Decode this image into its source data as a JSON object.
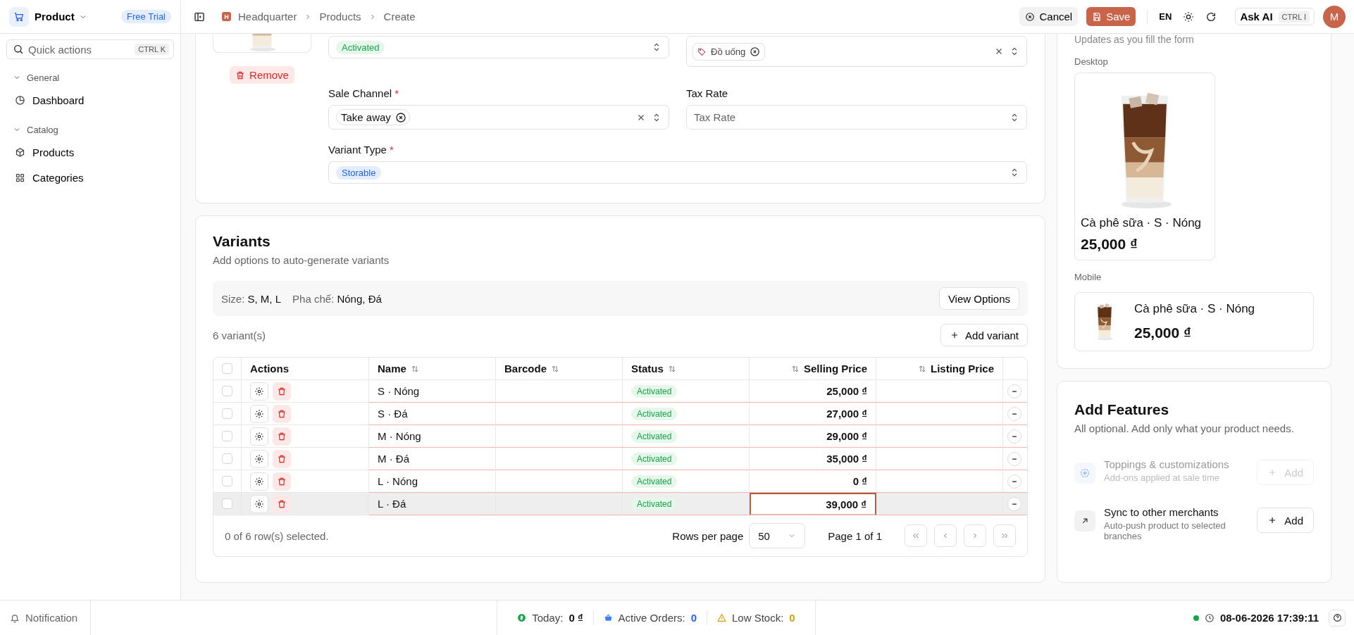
{
  "sidebar": {
    "app_name": "Product",
    "badge": "Free Trial",
    "search": {
      "placeholder": "Quick actions",
      "shortcut": "CTRL K"
    },
    "groups": [
      {
        "label": "General",
        "expanded": true,
        "items": [
          {
            "label": "Dashboard",
            "kind": "dashboard",
            "selected": false
          }
        ]
      },
      {
        "label": "Catalog",
        "expanded": true,
        "items": [
          {
            "label": "Products",
            "kind": "products",
            "selected": false
          },
          {
            "label": "Categories",
            "kind": "categories",
            "selected": false
          }
        ]
      }
    ]
  },
  "breadcrumb": {
    "badge": "H",
    "items": [
      "Headquarter",
      "Products",
      "Create"
    ]
  },
  "toolbar": {
    "cancel": "Cancel",
    "save": "Save",
    "language": "EN",
    "ask_ai": "Ask AI",
    "ask_ai_shortcut": "CTRL I",
    "avatar": "M"
  },
  "product_form": {
    "remove": "Remove",
    "status": {
      "value": "Activated"
    },
    "category": {
      "tag": "Đồ uống"
    },
    "sale_channel": {
      "label": "Sale Channel",
      "required_mark": "*",
      "tag": "Take away"
    },
    "tax_rate": {
      "label": "Tax Rate",
      "placeholder": "Tax Rate"
    },
    "variant_type": {
      "label": "Variant Type",
      "required_mark": "*",
      "value": "Storable"
    }
  },
  "variants": {
    "title": "Variants",
    "subtitle": "Add options to auto-generate variants",
    "options": [
      {
        "name": "Size:",
        "values": "S, M, L"
      },
      {
        "name": "Pha chế:",
        "values": "Nóng, Đá"
      }
    ],
    "view_options": "View Options",
    "count": "6 variant(s)",
    "add_variant": "Add variant",
    "table": {
      "all_selected": false,
      "columns": [
        {
          "label": "Actions",
          "sortable": false,
          "kind": "text"
        },
        {
          "label": "Name",
          "sortable": true,
          "kind": "text"
        },
        {
          "label": "Barcode",
          "sortable": true,
          "kind": "text"
        },
        {
          "label": "Status",
          "sortable": true,
          "kind": "text"
        },
        {
          "label": "Selling Price",
          "sortable": true,
          "kind": "number"
        },
        {
          "label": "Listing Price",
          "sortable": true,
          "kind": "number"
        }
      ],
      "rows": [
        {
          "selected": false,
          "hovered": false,
          "name": "S · Nóng",
          "status": "Activated",
          "selling_price": "25,000 ₫",
          "focused": false
        },
        {
          "selected": false,
          "hovered": false,
          "name": "S · Đá",
          "status": "Activated",
          "selling_price": "27,000 ₫",
          "focused": false
        },
        {
          "selected": false,
          "hovered": false,
          "name": "M · Nóng",
          "status": "Activated",
          "selling_price": "29,000 ₫",
          "focused": false
        },
        {
          "selected": false,
          "hovered": false,
          "name": "M · Đá",
          "status": "Activated",
          "selling_price": "35,000 ₫",
          "focused": false
        },
        {
          "selected": false,
          "hovered": false,
          "name": "L · Nóng",
          "status": "Activated",
          "selling_price": "0 ₫",
          "focused": false
        },
        {
          "selected": false,
          "hovered": true,
          "name": "L · Đá",
          "status": "Activated",
          "selling_price": "39,000 ₫",
          "focused": true
        }
      ]
    },
    "footer": {
      "selection": "0 of 6 row(s) selected.",
      "rows_per_page": "Rows per page",
      "page_size": "50",
      "page": "Page 1 of 1"
    }
  },
  "preview": {
    "subtitle": "Updates as you fill the form",
    "desktop_label": "Desktop",
    "desktop": {
      "name": "Cà phê sữa · S · Nóng",
      "price": "25,000 ₫"
    },
    "mobile_label": "Mobile",
    "mobile": {
      "name": "Cà phê sữa · S · Nóng",
      "price": "25,000 ₫"
    }
  },
  "features": {
    "title": "Add Features",
    "subtitle": "All optional. Add only what your product needs.",
    "items": [
      {
        "kind": "toppings",
        "title": "Toppings & customizations",
        "description": "Add-ons applied at sale time",
        "disabled": true,
        "button": "Add"
      },
      {
        "kind": "sync",
        "title": "Sync to other merchants",
        "description": "Auto-push product to selected branches",
        "disabled": false,
        "button": "Add"
      }
    ]
  },
  "status_bar": {
    "notification": "Notification",
    "stats": [
      {
        "kind": "revenue",
        "label": "Today:",
        "value": "0 ₫",
        "color": "#111111"
      },
      {
        "kind": "orders",
        "label": "Active Orders:",
        "value": "0",
        "color": "#2563eb"
      },
      {
        "kind": "stock",
        "label": "Low Stock:",
        "value": "0",
        "color": "#d4a106"
      }
    ],
    "online": true,
    "datetime": "08-06-2026 17:39:11"
  }
}
